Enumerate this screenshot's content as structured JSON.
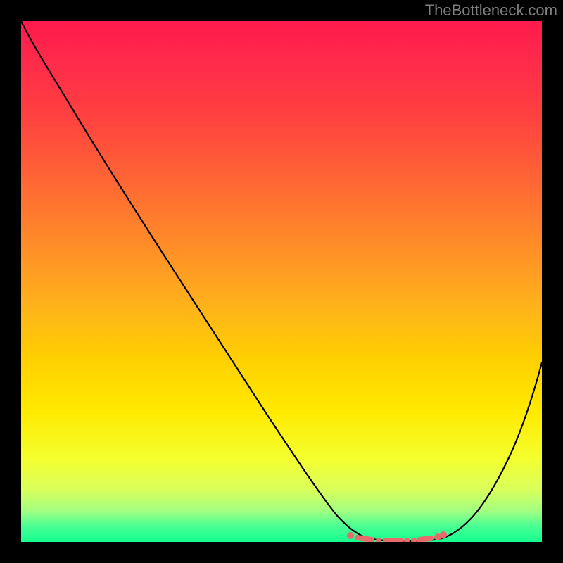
{
  "watermark": "TheBottleneck.com",
  "chart_data": {
    "type": "line",
    "title": "",
    "xlabel": "",
    "ylabel": "",
    "x_range": [
      0,
      100
    ],
    "y_range": [
      0,
      100
    ],
    "series": [
      {
        "name": "curve",
        "x": [
          0,
          5,
          10,
          15,
          20,
          25,
          30,
          35,
          40,
          45,
          50,
          55,
          60,
          62,
          65,
          68,
          70,
          72,
          75,
          78,
          80,
          83,
          86,
          90,
          95,
          100
        ],
        "y": [
          100,
          95,
          89,
          82,
          75,
          68,
          61,
          54,
          47,
          40,
          33,
          26,
          18,
          13,
          8,
          4,
          2,
          1,
          0.5,
          0.5,
          1,
          2,
          5,
          12,
          25,
          43
        ]
      }
    ],
    "highlighted_region": {
      "name": "bottleneck-band",
      "x_start": 62,
      "x_end": 82,
      "y": 0.5
    },
    "background": "rainbow-gradient-red-to-green"
  }
}
